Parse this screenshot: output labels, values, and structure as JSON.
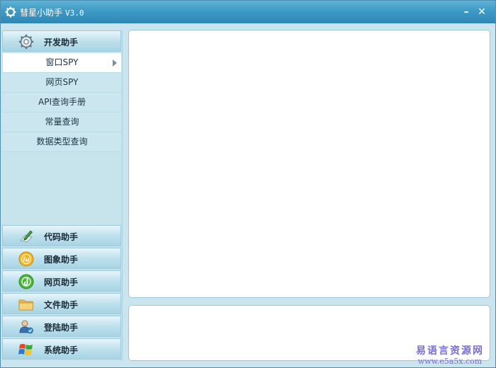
{
  "window": {
    "title": "彗星小助手",
    "version": "V3.0",
    "minimize_label": "–",
    "close_label": "✕"
  },
  "sidebar": {
    "active_group": {
      "label": "开发助手",
      "icon": "gear-icon",
      "items": [
        {
          "label": "窗口SPY",
          "active": true
        },
        {
          "label": "网页SPY"
        },
        {
          "label": "API查询手册"
        },
        {
          "label": "常量查询"
        },
        {
          "label": "数据类型查询"
        }
      ]
    },
    "groups": [
      {
        "label": "代码助手",
        "icon": "code-pen-icon"
      },
      {
        "label": "图象助手",
        "icon": "image-icon"
      },
      {
        "label": "网页助手",
        "icon": "web-icon"
      },
      {
        "label": "文件助手",
        "icon": "folder-icon"
      },
      {
        "label": "登陆助手",
        "icon": "user-login-icon"
      },
      {
        "label": "系统助手",
        "icon": "windows-icon"
      }
    ]
  },
  "watermark": {
    "line1": "易语言资源网",
    "line2": "www.e5a5x.com"
  }
}
